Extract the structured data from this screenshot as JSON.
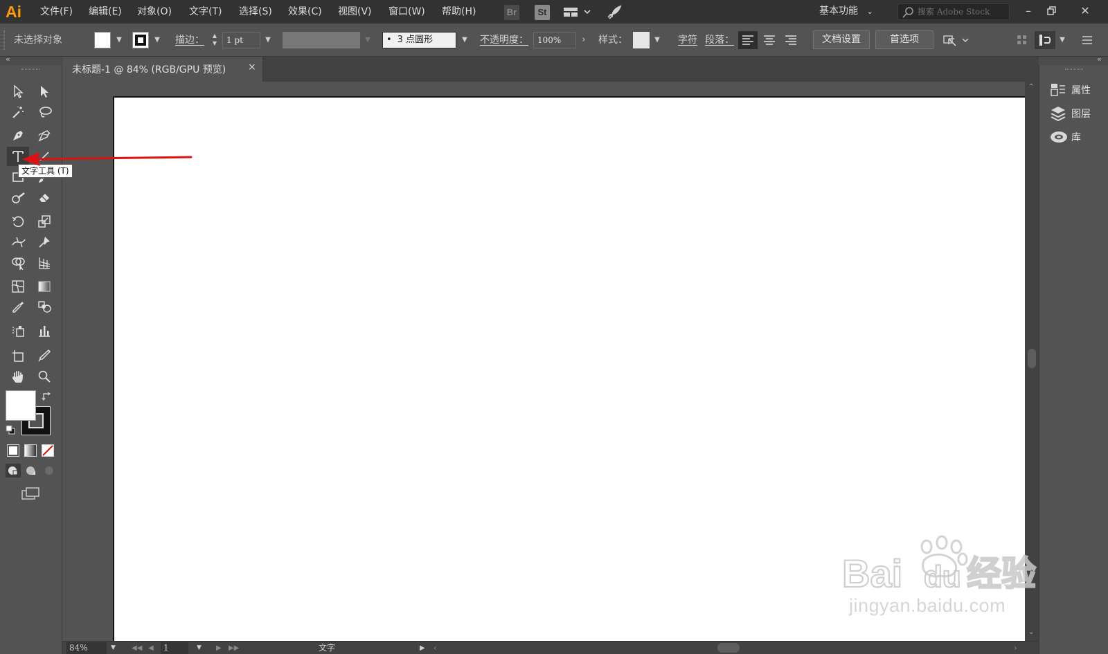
{
  "app": {
    "logo_text": "Ai"
  },
  "menu": {
    "items": [
      "文件(F)",
      "编辑(E)",
      "对象(O)",
      "文字(T)",
      "选择(S)",
      "效果(C)",
      "视图(V)",
      "窗口(W)",
      "帮助(H)"
    ],
    "bridge_label": "Br",
    "stock_label": "St",
    "workspace": "基本功能",
    "search_placeholder": "搜索 Adobe Stock"
  },
  "control_bar": {
    "selection_status": "未选择对象",
    "stroke_label": "描边：",
    "stroke_weight": "1 pt",
    "brush_definition": "3 点圆形",
    "opacity_label": "不透明度：",
    "opacity_value": "100%",
    "style_label": "样式：",
    "character_label": "字符",
    "paragraph_label": "段落：",
    "doc_setup_button": "文档设置",
    "preferences_button": "首选项"
  },
  "document": {
    "tab_title": "未标题-1 @ 84% (RGB/GPU 预览)",
    "close_glyph": "×"
  },
  "tooltip": {
    "text": "文字工具 (T)"
  },
  "status_bar": {
    "zoom": "84%",
    "artboard_number": "1",
    "current_tool": "文字"
  },
  "right_panel": {
    "items": [
      {
        "label": "属性",
        "icon": "properties-icon"
      },
      {
        "label": "图层",
        "icon": "layers-icon"
      },
      {
        "label": "库",
        "icon": "libraries-icon"
      }
    ]
  },
  "watermark": {
    "logo_text": "Bai du 经验",
    "url": "jingyan.baidu.com"
  },
  "colors": {
    "app_chrome": "#323232",
    "panel_bg": "#535353",
    "canvas_bg": "#ffffff",
    "logo_orange": "#ff9a00",
    "annotation_red": "#e01010"
  }
}
